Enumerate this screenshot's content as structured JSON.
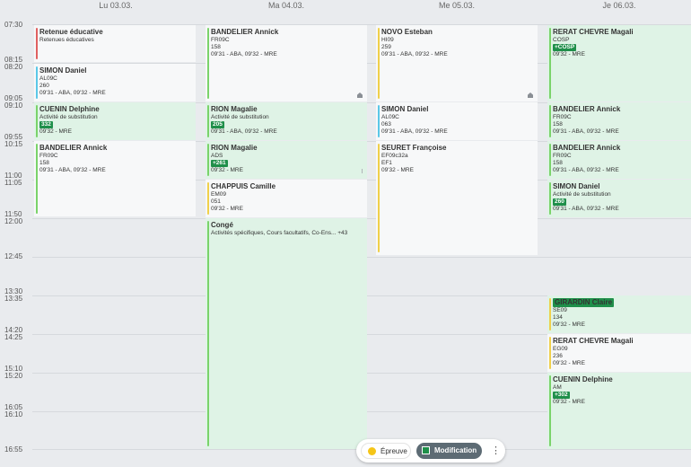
{
  "days": [
    "Lu 03.03.",
    "Ma 04.03.",
    "Me 05.03.",
    "Je 06.03."
  ],
  "times": [
    "07:30",
    "08:15",
    "08:20",
    "09:05",
    "09:10",
    "09:55",
    "10:15",
    "11:00",
    "11:05",
    "11:50",
    "12:00",
    "12:45",
    "13:30",
    "13:35",
    "14:20",
    "14:25",
    "15:10",
    "15:20",
    "16:05",
    "16:10",
    "16:55"
  ],
  "cards": [
    {
      "name": "Retenue éducative",
      "line1": "Retenues éducatives",
      "bar": "#e06060"
    },
    {
      "name": "SIMON Daniel",
      "line1": "AL09C",
      "line2": "260",
      "line3": "09'31 - ABA, 09'32 - MRE",
      "bar": "#5ac8e8"
    },
    {
      "name": "CUENIN Delphine",
      "line1": "Activité de substitution",
      "badge": "332",
      "line3": "09'32 - MRE",
      "bar": "#7ad36a"
    },
    {
      "name": "BANDELIER Annick",
      "line1": "FR09C",
      "line2": "158",
      "line3": "09'31 - ABA, 09'32 - MRE",
      "bar": "#7ad36a"
    },
    {
      "name": "BANDELIER Annick",
      "line1": "FR09C",
      "line2": "158",
      "line3": "09'31 - ABA, 09'32 - MRE",
      "bar": "#7ad36a"
    },
    {
      "name": "RION Magalie",
      "line1": "Activité de substitution",
      "badge": "205",
      "line3": "09'31 - ABA, 09'32 - MRE",
      "bar": "#7ad36a"
    },
    {
      "name": "RION Magalie",
      "line1": "ADS",
      "badge": "+261",
      "line3": "09'32 - MRE",
      "bar": "#7ad36a"
    },
    {
      "name": "CHAPPUIS Camille",
      "line1": "EM09",
      "line2": "051",
      "line3": "09'32 - MRE",
      "bar": "#f0d04a"
    },
    {
      "name": "Congé",
      "line1": "Activités spécifiques, Cours facultatifs, Co-Ens... +43",
      "bar": "#7ad36a"
    },
    {
      "name": "NOVO Esteban",
      "line1": "HI09",
      "line2": "259",
      "line3": "09'31 - ABA, 09'32 - MRE",
      "bar": "#f0d04a"
    },
    {
      "name": "SIMON Daniel",
      "line1": "AL09C",
      "line2": "063",
      "line3": "09'31 - ABA, 09'32 - MRE",
      "bar": "#5ac8e8"
    },
    {
      "name": "SEURET Françoise",
      "line1": "EF09c32a",
      "line2": "EF1",
      "line3": "09'32 - MRE",
      "bar": "#f0d04a"
    },
    {
      "name": "RERAT CHEVRE Magali",
      "line1": "COSP",
      "badge": "+COSP",
      "line3": "09'32 - MRE",
      "bar": "#7ad36a"
    },
    {
      "name": "BANDELIER Annick",
      "line1": "FR09C",
      "line2": "158",
      "line3": "09'31 - ABA, 09'32 - MRE",
      "bar": "#7ad36a"
    },
    {
      "name": "BANDELIER Annick",
      "line1": "FR09C",
      "line2": "158",
      "line3": "09'31 - ABA, 09'32 - MRE",
      "bar": "#7ad36a"
    },
    {
      "name": "SIMON Daniel",
      "line1": "Activité de substitution",
      "badge": "260",
      "line3": "09'31 - ABA, 09'32 - MRE",
      "bar": "#7ad36a"
    },
    {
      "name": "GIRARDIN Claire",
      "line1": "SE09",
      "line2": "134",
      "line3": "09'32 - MRE",
      "bar": "#f0d04a"
    },
    {
      "name": "RERAT CHEVRE Magali",
      "line1": "EG09",
      "line2": "236",
      "line3": "09'32 - MRE",
      "bar": "#f0d04a"
    },
    {
      "name": "CUENIN Delphine",
      "line1": "AM",
      "badge": "+302",
      "line3": "09'32 - MRE",
      "bar": "#7ad36a"
    }
  ],
  "legend": {
    "epreuve": "Épreuve",
    "modification": "Modification",
    "more": "⋮",
    "epreuve_color": "#f5c518",
    "modification_color": "#1f8f4a"
  },
  "icons": {
    "home": "home-icon",
    "resize": "resize-grip-icon"
  }
}
